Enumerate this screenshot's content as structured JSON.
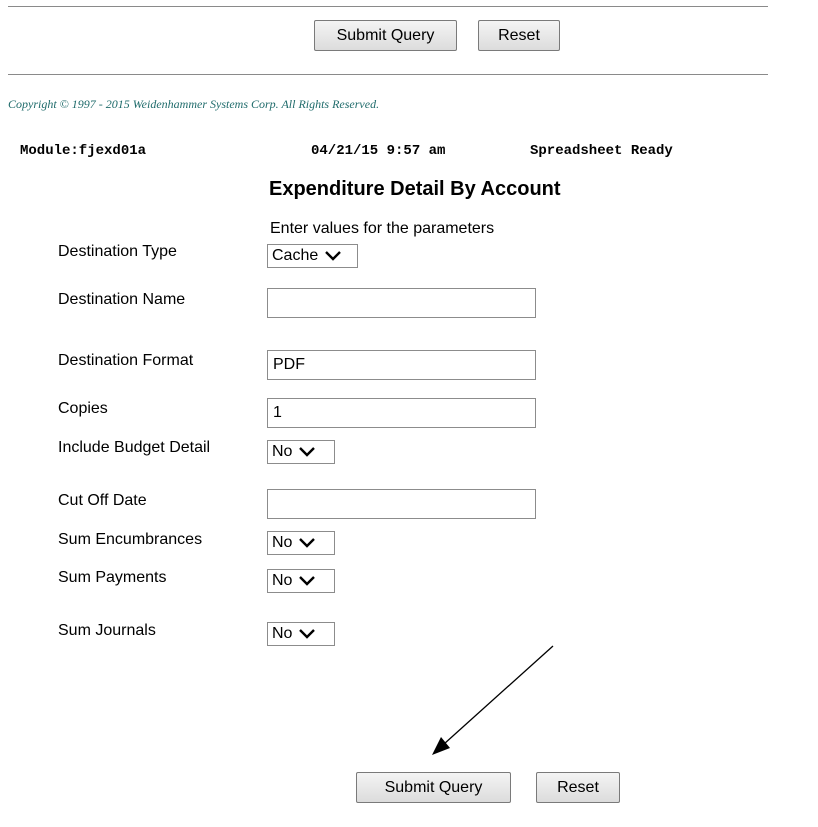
{
  "toolbar": {
    "submit_label": "Submit Query",
    "reset_label": "Reset"
  },
  "copyright": "Copyright © 1997 - 2015 Weidenhammer Systems Corp. All Rights Reserved.",
  "status": {
    "module": "Module:fjexd01a",
    "timestamp": "04/21/15 9:57 am",
    "state": "Spreadsheet Ready"
  },
  "form": {
    "title": "Expenditure Detail By Account",
    "instructions": "Enter values for the parameters",
    "fields": {
      "destination_type": {
        "label": "Destination Type",
        "value": "Cache"
      },
      "destination_name": {
        "label": "Destination Name",
        "value": ""
      },
      "destination_format": {
        "label": "Destination Format",
        "value": "PDF"
      },
      "copies": {
        "label": "Copies",
        "value": "1"
      },
      "include_budget_detail": {
        "label": "Include Budget Detail",
        "value": "No"
      },
      "cut_off_date": {
        "label": "Cut Off Date",
        "value": ""
      },
      "sum_encumbrances": {
        "label": "Sum Encumbrances",
        "value": "No"
      },
      "sum_payments": {
        "label": "Sum Payments",
        "value": "No"
      },
      "sum_journals": {
        "label": "Sum Journals",
        "value": "No"
      }
    }
  },
  "icons": {
    "dropdown": "chevron-down-icon",
    "annotation": "arrow-annotation"
  }
}
